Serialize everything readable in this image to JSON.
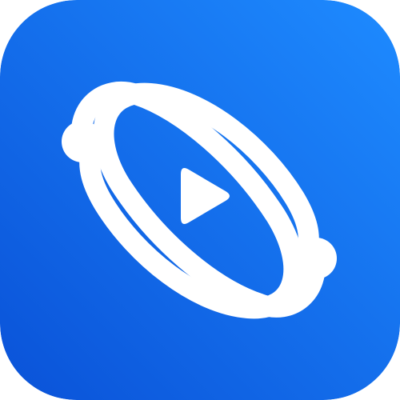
{
  "app_icon": {
    "icon": "atom-play-icon",
    "description_text": "",
    "colors": {
      "background_top_right": "#1E8BFF",
      "background_bottom_left": "#0A52D8",
      "glyph": "#FFFFFF"
    }
  }
}
